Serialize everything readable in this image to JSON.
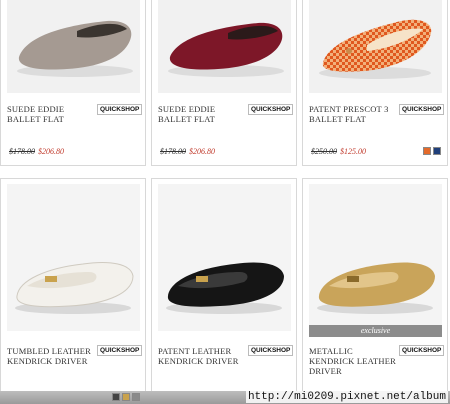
{
  "products": [
    {
      "name": "SUEDE EDDIE BALLET FLAT",
      "quickshop": "QUICKSHOP",
      "old_price": "$178.00",
      "sale_price": "$206.80",
      "icon": "ballet-flat-taupe",
      "color": "#a59a92",
      "swatches": []
    },
    {
      "name": "SUEDE EDDIE BALLET FLAT",
      "quickshop": "QUICKSHOP",
      "old_price": "$178.00",
      "sale_price": "$206.80",
      "icon": "ballet-flat-burgundy",
      "color": "#7d1728",
      "swatches": []
    },
    {
      "name": "PATENT PRESCOT 3 BALLET FLAT",
      "quickshop": "QUICKSHOP",
      "old_price": "$250.00",
      "sale_price": "$125.00",
      "icon": "ballet-flat-orange-check",
      "color": "#e0703a",
      "swatches": [
        "#e46a2a",
        "#1f3f7a"
      ]
    },
    {
      "name": "TUMBLED LEATHER KENDRICK DRIVER",
      "quickshop": "QUICKSHOP",
      "old_price": "",
      "sale_price": "",
      "icon": "driver-loafer-white",
      "color": "#f3f1ec",
      "swatches": [
        "#444444",
        "#c9a24d",
        "#8a8a8a"
      ]
    },
    {
      "name": "PATENT LEATHER KENDRICK DRIVER",
      "quickshop": "QUICKSHOP",
      "old_price": "",
      "sale_price": "",
      "icon": "driver-loafer-black",
      "color": "#151515",
      "swatches": []
    },
    {
      "name": "METALLIC KENDRICK LEATHER DRIVER",
      "quickshop": "QUICKSHOP",
      "old_price": "",
      "sale_price": "",
      "icon": "driver-loafer-gold",
      "color": "#c9a45a",
      "badge": "exclusive",
      "swatches": []
    }
  ],
  "watermark": "http://mi0209.pixnet.net/album"
}
